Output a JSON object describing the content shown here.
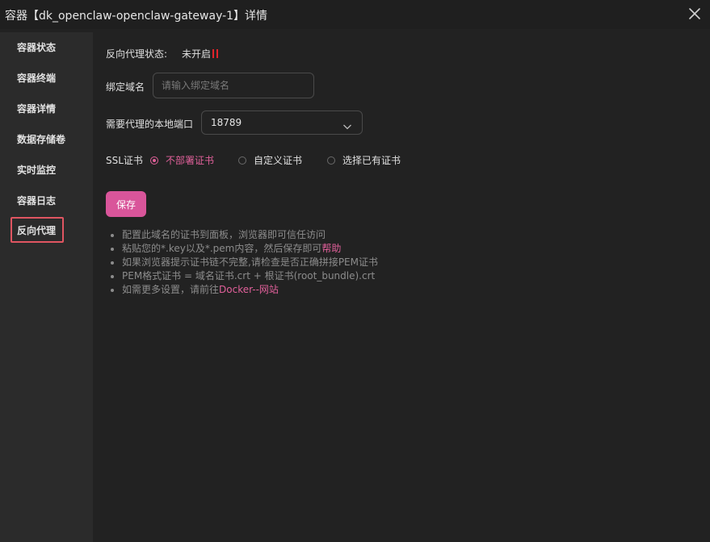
{
  "window": {
    "title": "容器【dk_openclaw-openclaw-gateway-1】详情"
  },
  "sidebar": {
    "items": [
      {
        "label": "容器状态"
      },
      {
        "label": "容器终端"
      },
      {
        "label": "容器详情"
      },
      {
        "label": "数据存储卷"
      },
      {
        "label": "实时监控"
      },
      {
        "label": "容器日志"
      },
      {
        "label": "反向代理",
        "active": true
      }
    ]
  },
  "proxy": {
    "status_label": "反向代理状态:",
    "status_value": "未开启",
    "domain_label": "绑定域名",
    "domain_placeholder": "请输入绑定域名",
    "domain_value": "",
    "port_label": "需要代理的本地端口",
    "port_value": "18789",
    "ssl_label": "SSL证书",
    "ssl_options": [
      {
        "label": "不部署证书",
        "checked": true
      },
      {
        "label": "自定义证书",
        "checked": false
      },
      {
        "label": "选择已有证书",
        "checked": false
      }
    ],
    "save_label": "保存"
  },
  "tips": {
    "t1": "配置此域名的证书到面板，浏览器即可信任访问",
    "t2_text": "粘贴您的*.key以及*.pem内容，然后保存即可",
    "t2_link": "帮助",
    "t3": "如果浏览器提示证书链不完整,请检查是否正确拼接PEM证书",
    "t4": "PEM格式证书 = 域名证书.crt + 根证书(root_bundle).crt",
    "t5_text": "如需更多设置，请前往",
    "t5_link": "Docker--网站"
  },
  "colors": {
    "accent": "#d9559a",
    "accent_text": "#e0609a",
    "status_off": "#e0232b",
    "highlight_border": "#e05561",
    "background": "#222222",
    "sidebar": "#2b2b2b"
  },
  "icons": {
    "close": "close-icon",
    "dropdown": "chevron-down-icon",
    "status": "status-off-icon"
  }
}
